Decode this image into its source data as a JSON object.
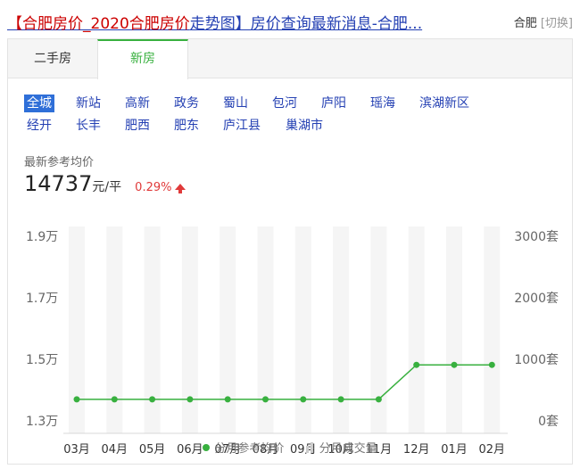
{
  "header": {
    "title_highlight": "【合肥房价_2020合肥房价",
    "title_rest": "走势图】房价查询最新消息-合肥...",
    "city": "合肥",
    "switch_label": "[切换]"
  },
  "tabs": [
    {
      "label": "二手房",
      "active": false
    },
    {
      "label": "新房",
      "active": true
    }
  ],
  "districts": [
    [
      "全城",
      "新站",
      "高新",
      "政务",
      "蜀山",
      "包河",
      "庐阳",
      "瑶海",
      "滨湖新区"
    ],
    [
      "经开",
      "长丰",
      "肥西",
      "肥东",
      "庐江县",
      "巢湖市"
    ]
  ],
  "active_district": "全城",
  "price": {
    "label": "最新参考均价",
    "value": "14737",
    "unit": "元/平",
    "change": "0.29%",
    "direction": "up"
  },
  "colors": {
    "accent_green": "#38b03f",
    "link_blue": "#2440b3",
    "up_red": "#e03a3a"
  },
  "chart_data": {
    "type": "line",
    "categories": [
      "03月",
      "04月",
      "05月",
      "06月",
      "07月",
      "08月",
      "09月",
      "10月",
      "11月",
      "12月",
      "01月",
      "02月"
    ],
    "series": [
      {
        "name": "分月参考均价",
        "axis": "left",
        "values": [
          13700,
          13700,
          13700,
          13700,
          13700,
          13700,
          13700,
          13700,
          13700,
          14820,
          14820,
          14820
        ]
      },
      {
        "name": "分月成交量",
        "axis": "right",
        "values": [
          0,
          0,
          0,
          0,
          0,
          0,
          0,
          0,
          0,
          0,
          0,
          0
        ]
      }
    ],
    "left_ticks": [
      "1.9万",
      "1.7万",
      "1.5万",
      "1.3万"
    ],
    "left_tick_values": [
      19000,
      17000,
      15000,
      13000
    ],
    "right_ticks": [
      "3000套",
      "2000套",
      "1000套",
      "0套"
    ],
    "right_tick_values": [
      3000,
      2000,
      1000,
      0
    ],
    "ylim": [
      13000,
      19000
    ],
    "ylim_right": [
      0,
      3000
    ],
    "legend": [
      "分月参考均价",
      "分月成交量"
    ],
    "legend_position": "bottom"
  }
}
